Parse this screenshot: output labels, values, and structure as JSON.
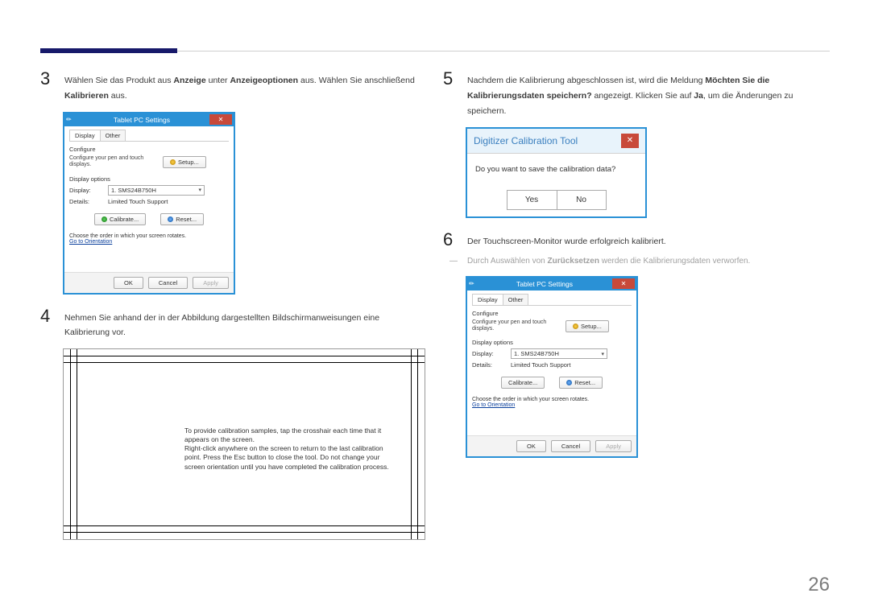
{
  "page_number": "26",
  "step3": {
    "num": "3",
    "t1": "Wählen Sie das Produkt aus ",
    "b1": "Anzeige",
    "t2": " unter ",
    "b2": "Anzeigeoptionen",
    "t3": " aus. Wählen Sie anschließend ",
    "b3": "Kalibrieren",
    "t4": " aus."
  },
  "win_settings": {
    "title": "Tablet PC Settings",
    "tab_display": "Display",
    "tab_other": "Other",
    "configure": "Configure",
    "configure_sub": "Configure your pen and touch displays.",
    "setup": "Setup...",
    "display_options": "Display options",
    "display_label": "Display:",
    "display_value": "1. SMS24B750H",
    "details_label": "Details:",
    "details_value": "Limited Touch Support",
    "calibrate": "Calibrate...",
    "reset": "Reset...",
    "orientation_text": "Choose the order in which your screen rotates.",
    "orientation_link": "Go to Orientation",
    "ok": "OK",
    "cancel": "Cancel",
    "apply": "Apply"
  },
  "step4": {
    "num": "4",
    "text": "Nehmen Sie anhand der in der Abbildung dargestellten Bildschirmanweisungen eine Kalibrierung vor."
  },
  "calib_text": "To provide calibration samples, tap the crosshair each time that it appears on the screen.\nRight-click anywhere on the screen to return to the last calibration point. Press the Esc button to close the tool. Do not change your screen orientation until you have completed the calibration process.",
  "step5": {
    "num": "5",
    "t1": "Nachdem die Kalibrierung abgeschlossen ist, wird die Meldung ",
    "b1": "Möchten Sie die Kalibrierungsdaten speichern?",
    "t2": " angezeigt. Klicken Sie auf ",
    "b2": "Ja",
    "t3": ", um die Änderungen zu speichern."
  },
  "digi": {
    "title": "Digitizer Calibration Tool",
    "msg": "Do you want to save the calibration data?",
    "yes": "Yes",
    "no": "No"
  },
  "step6": {
    "num": "6",
    "text": "Der Touchscreen-Monitor wurde erfolgreich kalibriert."
  },
  "note": {
    "mark": "―",
    "t1": "Durch Auswählen von ",
    "b1": "Zurücksetzen",
    "t2": " werden die Kalibrierungsdaten verworfen."
  }
}
